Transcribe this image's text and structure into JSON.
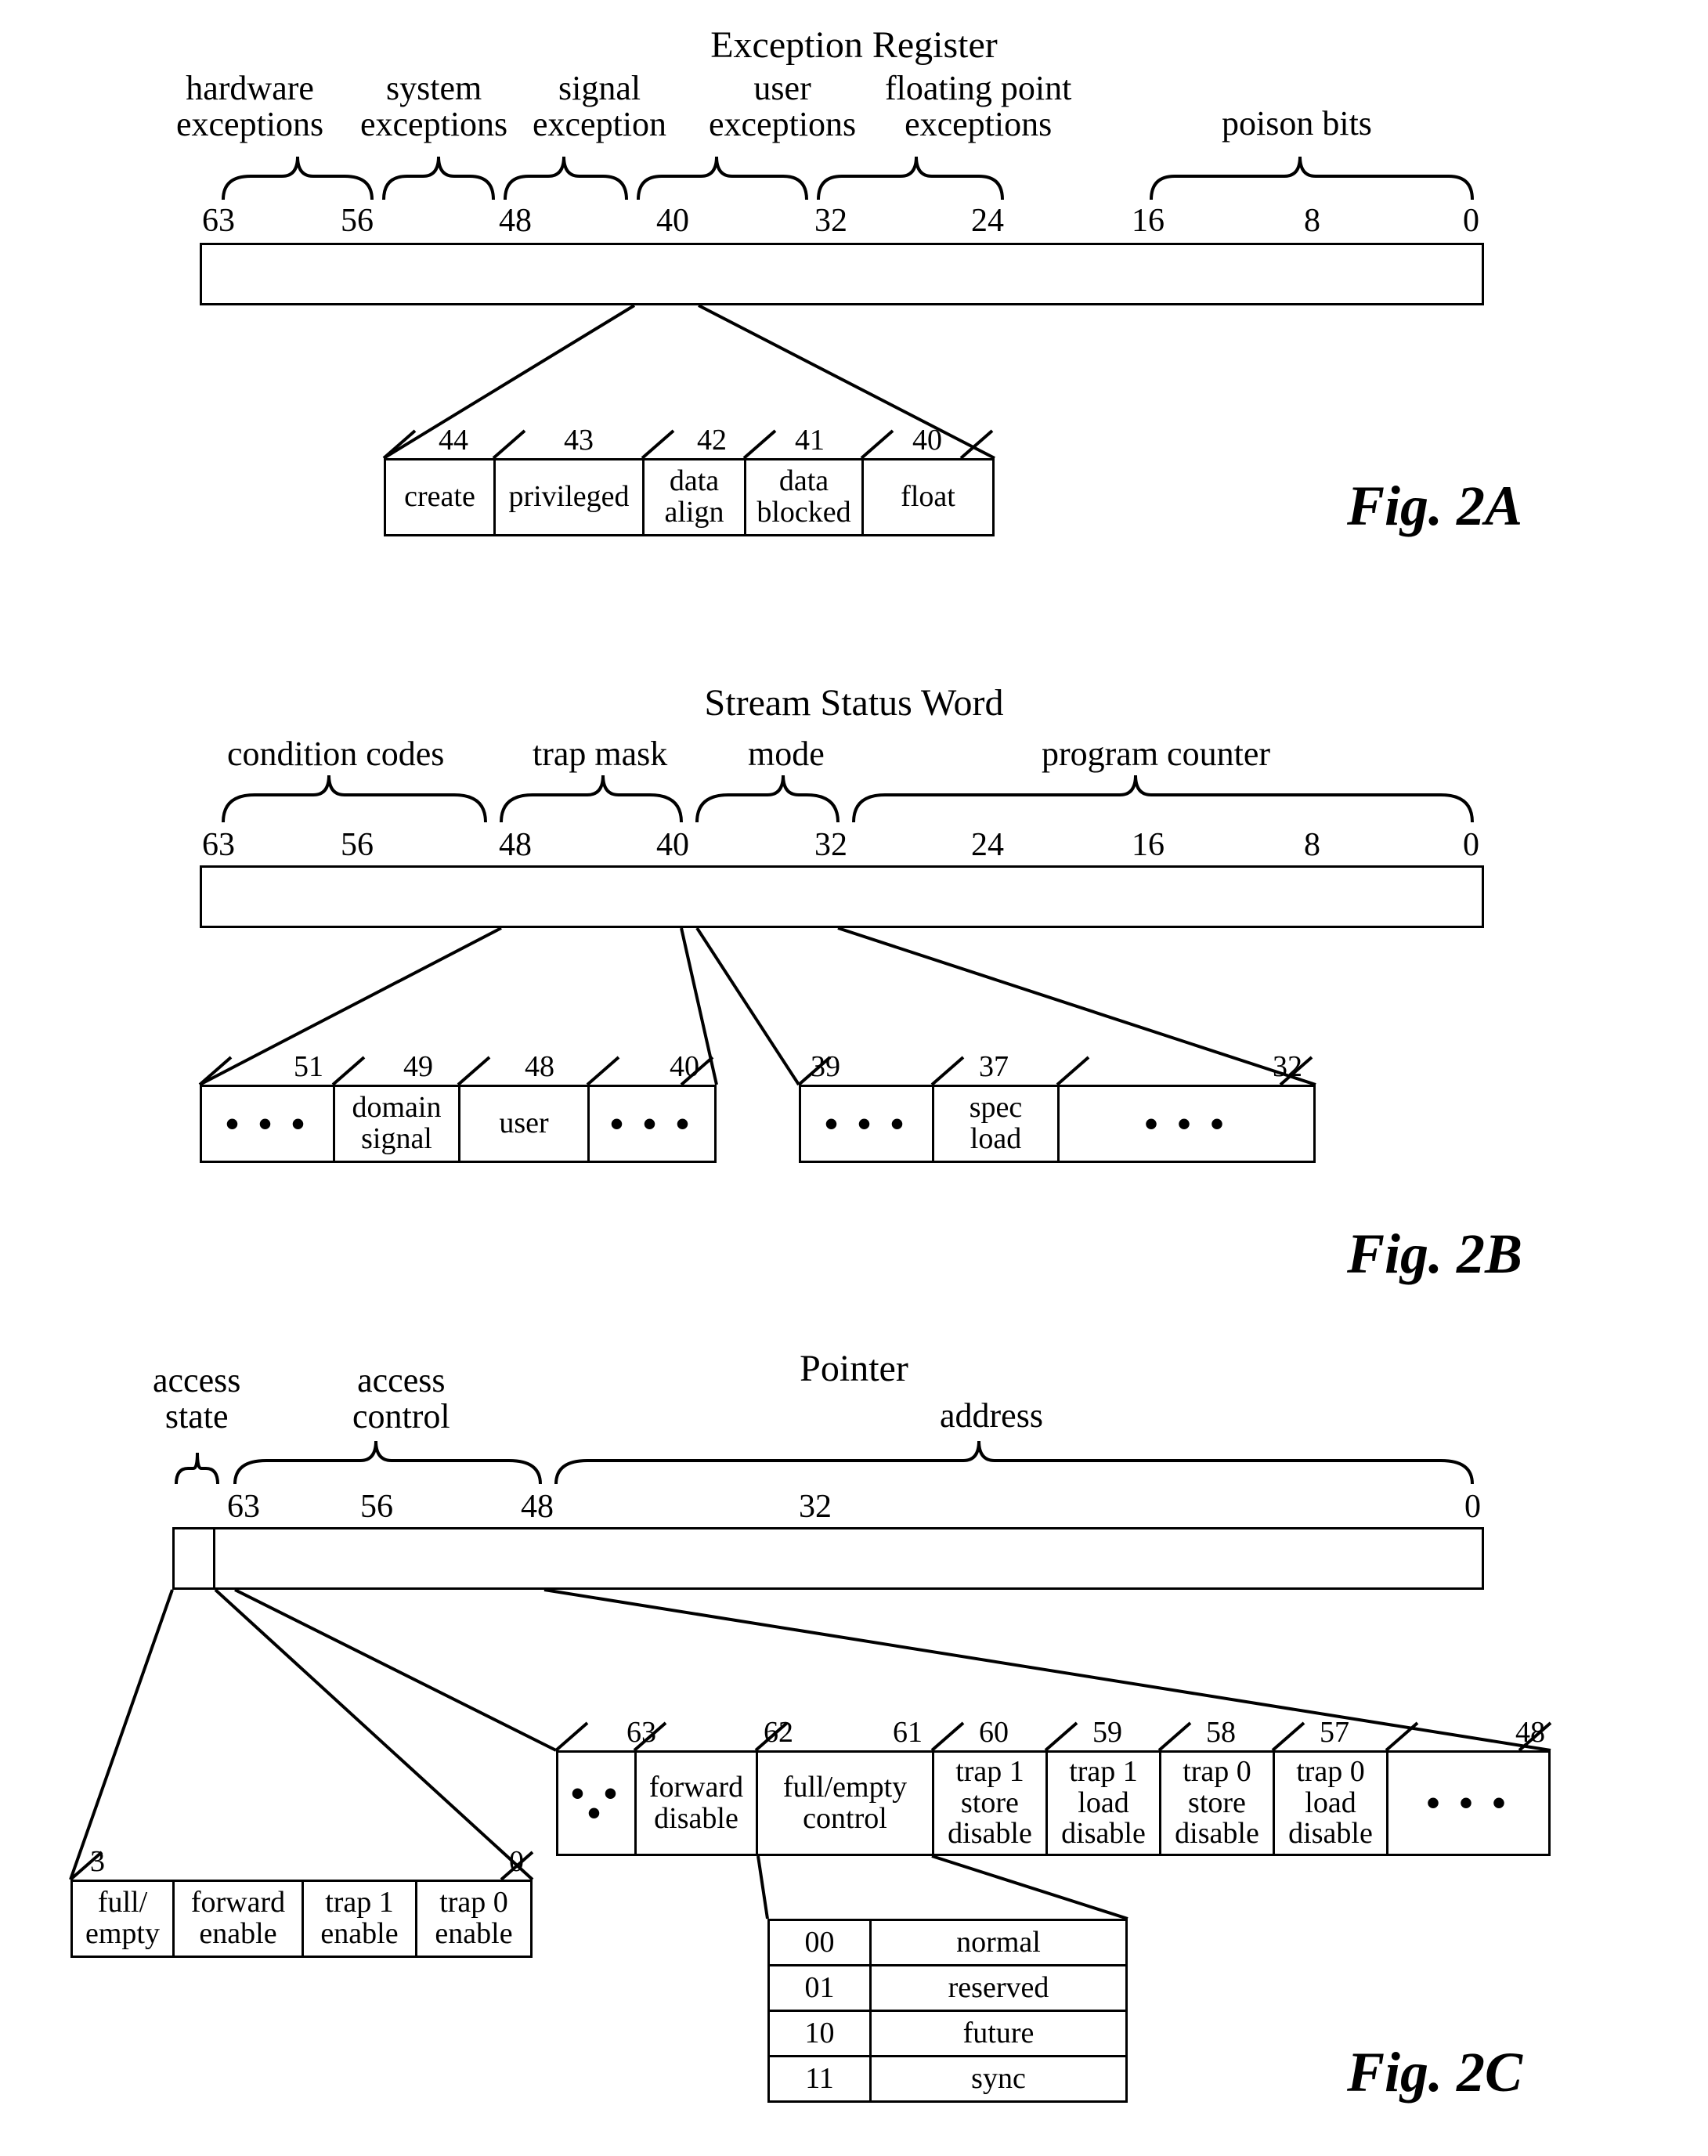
{
  "figA": {
    "title": "Exception Register",
    "top_labels": {
      "hw": "hardware\nexceptions",
      "sys": "system\nexceptions",
      "sig": "signal\nexception",
      "user": "user\nexceptions",
      "fp": "floating point\nexceptions",
      "poison": "poison bits"
    },
    "ticks": [
      "63",
      "56",
      "48",
      "40",
      "32",
      "24",
      "16",
      "8",
      "0"
    ],
    "detail_nums": [
      "44",
      "43",
      "42",
      "41",
      "40"
    ],
    "detail_cells": [
      "create",
      "privileged",
      "data\nalign",
      "data\nblocked",
      "float"
    ],
    "caption": "Fig. 2A"
  },
  "figB": {
    "title": "Stream Status Word",
    "top_labels": {
      "cc": "condition codes",
      "tm": "trap mask",
      "mode": "mode",
      "pc": "program counter"
    },
    "ticks": [
      "63",
      "56",
      "48",
      "40",
      "32",
      "24",
      "16",
      "8",
      "0"
    ],
    "left_nums": [
      "51",
      "49",
      "48",
      "40"
    ],
    "left_cells": [
      "• • •",
      "domain\nsignal",
      "user",
      "• • •"
    ],
    "right_nums": [
      "39",
      "37",
      "32"
    ],
    "right_cells": [
      "• • •",
      "spec\nload",
      "• • •"
    ],
    "caption": "Fig. 2B"
  },
  "figC": {
    "title": "Pointer",
    "top_labels": {
      "as": "access\nstate",
      "ac": "access\ncontrol",
      "addr": "address"
    },
    "ticks": [
      "63",
      "56",
      "48",
      "32",
      "0"
    ],
    "tag_nums": [
      "3",
      "0"
    ],
    "tag_cells": [
      "full/\nempty",
      "forward\nenable",
      "trap 1\nenable",
      "trap 0\nenable"
    ],
    "acc_nums": [
      "63",
      "62",
      "61",
      "60",
      "59",
      "58",
      "57",
      "48"
    ],
    "acc_cells": [
      "• • •",
      "forward\ndisable",
      "full/empty\ncontrol",
      "trap 1\nstore\ndisable",
      "trap 1\nload\ndisable",
      "trap 0\nstore\ndisable",
      "trap 0\nload\ndisable",
      "• • •"
    ],
    "table": [
      [
        "00",
        "normal"
      ],
      [
        "01",
        "reserved"
      ],
      [
        "10",
        "future"
      ],
      [
        "11",
        "sync"
      ]
    ],
    "caption": "Fig. 2C"
  }
}
